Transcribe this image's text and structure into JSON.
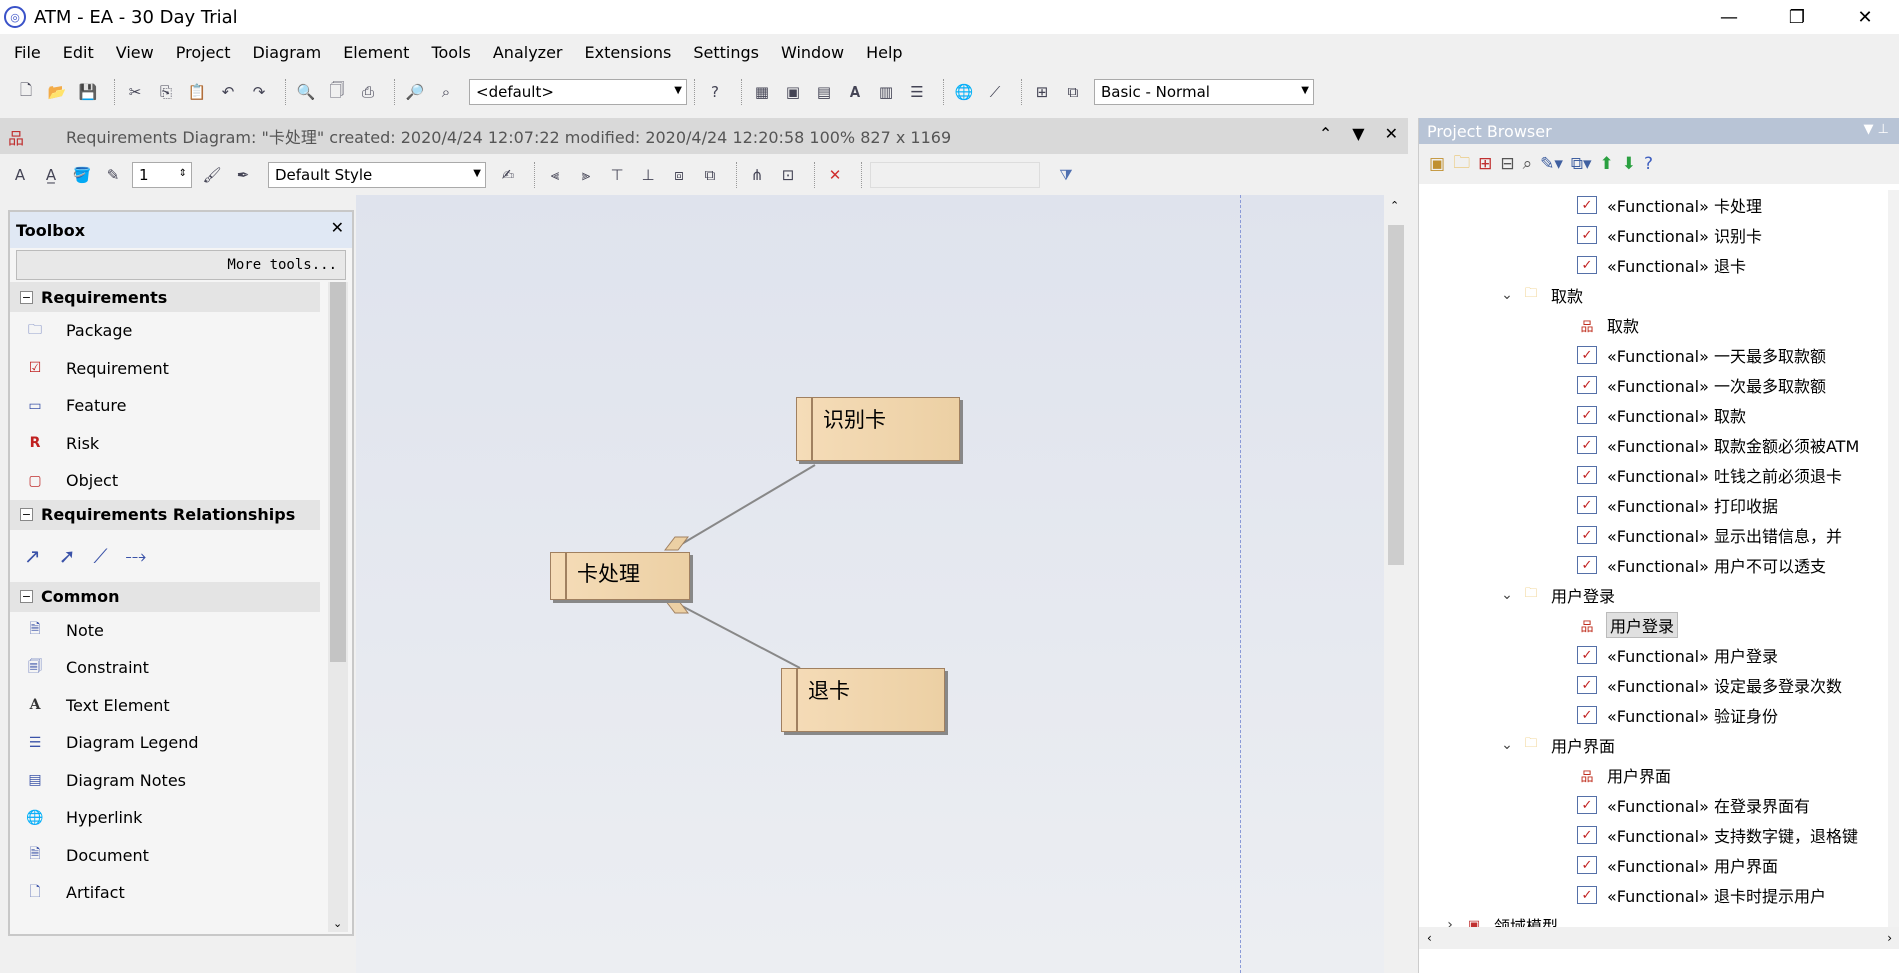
{
  "window": {
    "title": "ATM - EA - 30 Day Trial",
    "minimize": "—",
    "restore": "❐",
    "close": "✕"
  },
  "menu": [
    "File",
    "Edit",
    "View",
    "Project",
    "Diagram",
    "Element",
    "Tools",
    "Analyzer",
    "Extensions",
    "Settings",
    "Window",
    "Help"
  ],
  "toolbar": {
    "perspective_combo": "<default>",
    "workspace_combo": "Basic - Normal"
  },
  "diagram_header": {
    "text": "Requirements Diagram: \"卡处理\"   created: 2020/4/24 12:07:22  modified: 2020/4/24 12:20:58   100%   827 x 1169"
  },
  "format_bar": {
    "line_width": "1",
    "style_combo": "Default Style"
  },
  "toolbox": {
    "title": "Toolbox",
    "more_tools": "More tools...",
    "groups": [
      {
        "label": "Requirements",
        "items": [
          "Package",
          "Requirement",
          "Feature",
          "Risk",
          "Object"
        ]
      },
      {
        "label": "Requirements Relationships"
      },
      {
        "label": "Common",
        "items": [
          "Note",
          "Constraint",
          "Text Element",
          "Diagram Legend",
          "Diagram Notes",
          "Hyperlink",
          "Document",
          "Artifact"
        ]
      }
    ]
  },
  "diagram": {
    "nodes": [
      "识别卡",
      "卡处理",
      "退卡"
    ]
  },
  "browser": {
    "title": "Project Browser",
    "rows": [
      {
        "label": "«Functional» 卡处理",
        "kind": "req"
      },
      {
        "label": "«Functional» 识别卡",
        "kind": "req"
      },
      {
        "label": "«Functional» 退卡",
        "kind": "req"
      },
      {
        "label": "取款",
        "kind": "folder"
      },
      {
        "label": "取款",
        "kind": "diag"
      },
      {
        "label": "«Functional» 一天最多取款额",
        "kind": "req"
      },
      {
        "label": "«Functional» 一次最多取款额",
        "kind": "req"
      },
      {
        "label": "«Functional» 取款",
        "kind": "req"
      },
      {
        "label": "«Functional» 取款金额必须被ATM",
        "kind": "req"
      },
      {
        "label": "«Functional» 吐钱之前必须退卡",
        "kind": "req"
      },
      {
        "label": "«Functional» 打印收据",
        "kind": "req"
      },
      {
        "label": "«Functional» 显示出错信息，并",
        "kind": "req"
      },
      {
        "label": "«Functional» 用户不可以透支",
        "kind": "req"
      },
      {
        "label": "用户登录",
        "kind": "folder"
      },
      {
        "label": "用户登录",
        "kind": "diag",
        "selected": true
      },
      {
        "label": "«Functional» 用户登录",
        "kind": "req"
      },
      {
        "label": "«Functional» 设定最多登录次数",
        "kind": "req"
      },
      {
        "label": "«Functional» 验证身份",
        "kind": "req"
      },
      {
        "label": "用户界面",
        "kind": "folder"
      },
      {
        "label": "用户界面",
        "kind": "diag"
      },
      {
        "label": "«Functional» 在登录界面有",
        "kind": "req"
      },
      {
        "label": "«Functional» 支持数字键，退格键",
        "kind": "req"
      },
      {
        "label": "«Functional» 用户界面",
        "kind": "req"
      },
      {
        "label": "«Functional» 退卡时提示用户",
        "kind": "req"
      },
      {
        "label": "领域模型",
        "kind": "pkg"
      }
    ]
  }
}
